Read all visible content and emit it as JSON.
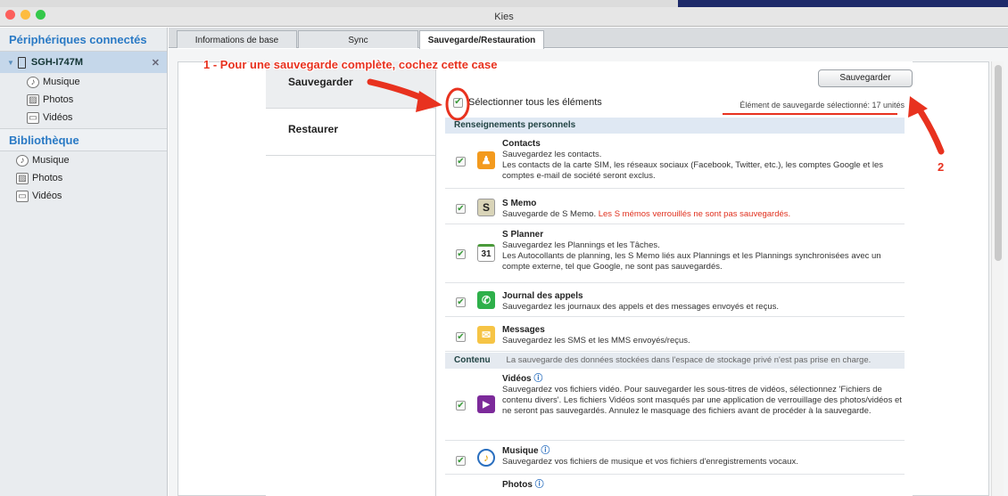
{
  "window": {
    "title": "Kies"
  },
  "sidebar": {
    "connected_heading": "Périphériques connectés",
    "device_name": "SGH-I747M",
    "device_close": "✕",
    "device_items": [
      {
        "label": "Musique"
      },
      {
        "label": "Photos"
      },
      {
        "label": "Vidéos"
      }
    ],
    "library_heading": "Bibliothèque",
    "library_items": [
      {
        "label": "Musique"
      },
      {
        "label": "Photos"
      },
      {
        "label": "Vidéos"
      }
    ]
  },
  "tabs": [
    {
      "label": "Informations de base"
    },
    {
      "label": "Sync"
    },
    {
      "label": "Sauvegarde/Restauration",
      "active": true
    }
  ],
  "left_menu": [
    {
      "label": "Sauvegarder",
      "active": true
    },
    {
      "label": "Restaurer"
    }
  ],
  "panel": {
    "save_button": "Sauvegarder",
    "select_all_label": "Sélectionner tous les éléments",
    "selected_count": "Élément de sauvegarde sélectionné: 17 unités",
    "section_personal": "Renseignements personnels",
    "section_content": "Contenu",
    "section_content_note": "La sauvegarde des données stockées dans l'espace de stockage privé n'est pas prise en charge.",
    "items": [
      {
        "title": "Contacts",
        "line1": "Sauvegardez les contacts.",
        "line2": "Les contacts de la carte SIM, les réseaux sociaux (Facebook, Twitter, etc.), les comptes Google et les comptes e-mail de société seront exclus.",
        "icon": "contacts-icon",
        "color": "#f39a1e"
      },
      {
        "title": "S Memo",
        "line1": "Sauvegarde de S Memo.",
        "warning": "Les S mémos verrouillés ne sont pas sauvegardés.",
        "icon": "s-memo-icon",
        "color": "#d9d4b8"
      },
      {
        "title": "S Planner",
        "line1": "Sauvegardez les Plannings et les Tâches.",
        "line2": "Les Autocollants de planning, les S Memo liés aux Plannings et les Plannings synchronisées avec un compte externe, tel que Google, ne sont pas sauvegardés.",
        "icon": "calendar-icon",
        "color": "#ffffff"
      },
      {
        "title": "Journal des appels",
        "line1": "Sauvegardez les journaux des appels et des messages envoyés et reçus.",
        "icon": "phone-call-icon",
        "color": "#2eb04a"
      },
      {
        "title": "Messages",
        "line1": "Sauvegardez les SMS et les MMS envoyés/reçus.",
        "icon": "envelope-icon",
        "color": "#f6c445"
      },
      {
        "title": "Vidéos",
        "line1": "Sauvegardez vos fichiers vidéo. Pour sauvegarder les sous-titres de vidéos, sélectionnez 'Fichiers de contenu divers'. Les fichiers Vidéos sont masqués par une application de verrouillage des photos/vidéos et ne seront pas sauvegardés. Annulez le masquage des fichiers avant de procéder à la sauvegarde.",
        "icon": "video-play-icon",
        "color": "#7c2a9a"
      },
      {
        "title": "Musique",
        "line1": "Sauvegardez vos fichiers de musique et vos fichiers d'enregistrements vocaux.",
        "icon": "music-note-icon",
        "color": "#ffffff"
      },
      {
        "title": "Photos",
        "icon": "photos-icon",
        "color": "#ffffff"
      }
    ]
  },
  "annotations": {
    "step1": "1 - Pour une sauvegarde complète, cochez cette case",
    "step2": "2",
    "color": "#e8321f"
  }
}
